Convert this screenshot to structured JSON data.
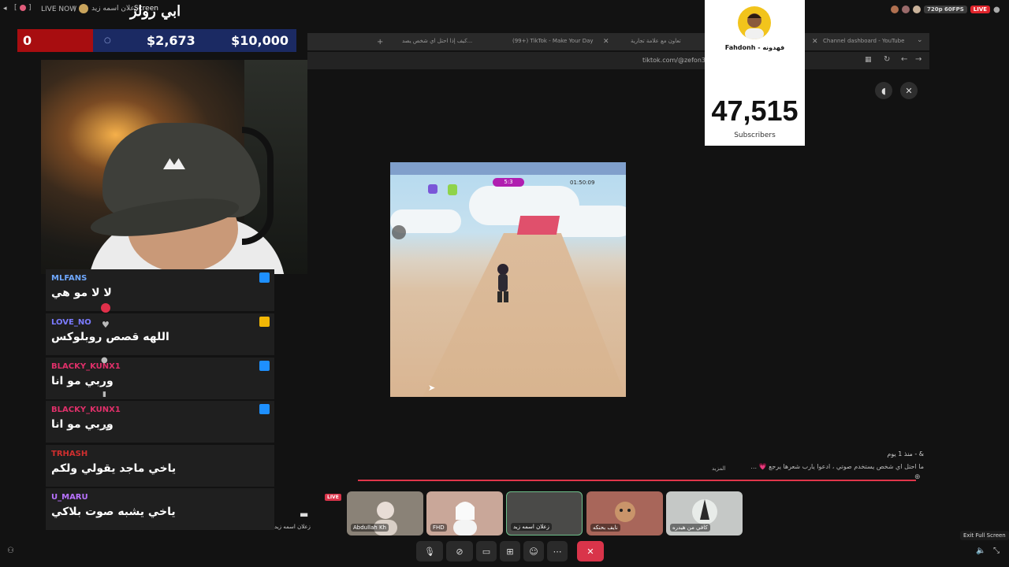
{
  "topbar": {
    "live_label": "LIVE NOW",
    "host_name": "زعلان اسمه زيد",
    "secondary_label": "Screen",
    "stream_title": "ابي رولز"
  },
  "goal": {
    "current_red": "0",
    "current": "$2,673",
    "target": "$10,000"
  },
  "browser": {
    "tabs": [
      "كيف إذا احتل اي شخص يصد...",
      "(99+) TikTok - Make Your Day",
      "تعاون مع علامة تجارية",
      "Channel dashboard - YouTube"
    ],
    "url": "tiktok.com/@zefon3/v... ...25-9BaA72IHQAa"
  },
  "subscriber_card": {
    "channel_name": "Fahdonh - فهدونه",
    "count": "47,515",
    "label": "Subscribers"
  },
  "top_right": {
    "quality": "720p 60FPS",
    "live": "LIVE"
  },
  "game": {
    "score": "5:3",
    "timer": "01:50:09"
  },
  "chat": {
    "messages": [
      {
        "user": "MLFANS",
        "text": "لا لا مو هي",
        "color": "#6fa8ff",
        "badge_color": "#1e90ff"
      },
      {
        "user": "LOVE_NO",
        "text": "اللهه قصص روبلوكس",
        "color": "#7b7bff",
        "badge_color": "#f2b705"
      },
      {
        "user": "BLACKY_KUNX1",
        "text": "وربي مو انا",
        "color": "#e0306a",
        "badge_color": "#1e90ff"
      },
      {
        "user": "BLACKY_KUNX1",
        "text": "وربي مو انا",
        "color": "#e0306a",
        "badge_color": "#1e90ff"
      },
      {
        "user": "TRHASH",
        "text": "ياخي ماجد يقولي ولكم",
        "color": "#d12f2f",
        "badge_color": ""
      },
      {
        "user": "U_MARU",
        "text": "ياخي يشبه صوت بلاكي",
        "color": "#b872ff",
        "badge_color": ""
      }
    ]
  },
  "comment": {
    "meta": "& - منذ 1 يوم",
    "text": "ما احتل اي شخص يستخدم صوتي ، ادعوا يارب شعرها يرجع 💗 ...",
    "more": "المزيد"
  },
  "participants": {
    "self_live": "LIVE",
    "self_name": "زعلان اسمه زيد",
    "tiles": [
      {
        "name": "Abdullah Kh",
        "bg": "#8a8277"
      },
      {
        "name": "FHD",
        "bg": "#c9a799"
      },
      {
        "name": "زعلان اسمه زيد",
        "bg": "#4a4a48"
      },
      {
        "name": "نايف بحنكه",
        "bg": "#a8665a"
      },
      {
        "name": "كافي من هيدره",
        "bg": "#c5c8c6"
      }
    ]
  },
  "exit_full_screen": "Exit Full Screen"
}
